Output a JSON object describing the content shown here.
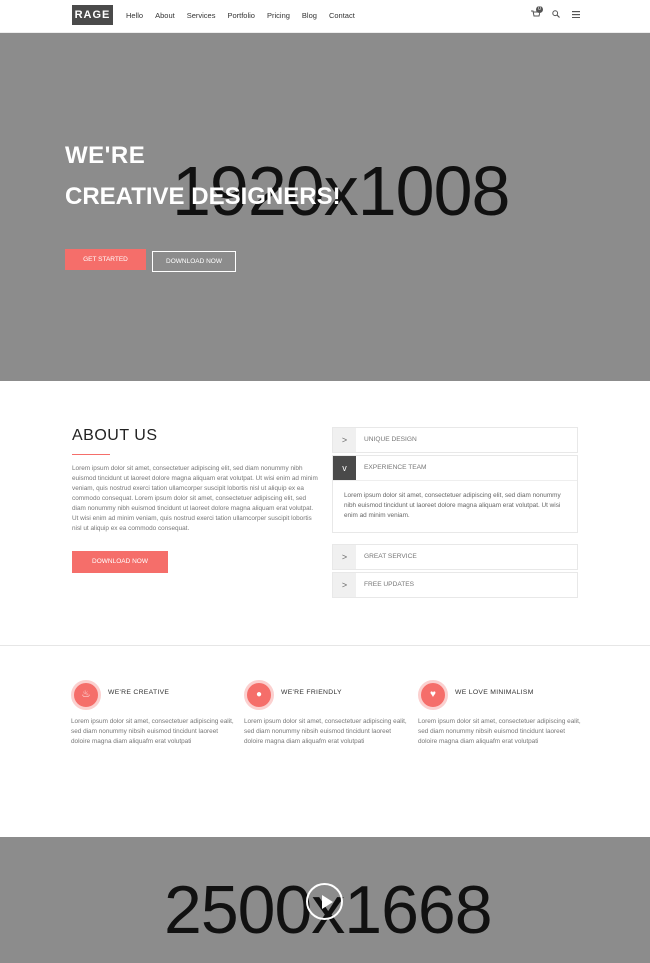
{
  "nav": {
    "logo": "RAGE",
    "menu": [
      "Hello",
      "About",
      "Services",
      "Portfolio",
      "Pricing",
      "Blog",
      "Contact"
    ],
    "cart_icon": "cart-icon",
    "cart_count": "0",
    "search_icon": "search-icon",
    "menu_icon": "hamburger-icon"
  },
  "hero": {
    "placeholder": "1920x1008",
    "line1": "WE'RE",
    "line2": "CREATIVE DESIGNERS!",
    "primary_button": "GET STARTED",
    "secondary_button": "DOWNLOAD NOW"
  },
  "about": {
    "title": "ABOUT US",
    "text": "Lorem ipsum dolor sit amet, consectetuer adipiscing elit, sed diam nonummy nibh euismod tincidunt ut laoreet dolore magna aliquam erat volutpat. Ut wisi enim ad minim veniam, quis nostrud exerci tation ullamcorper suscipit lobortis nisl ut aliquip ex ea commodo consequat. Lorem ipsum dolor sit amet, consectetuer adipiscing elit, sed diam nonummy nibh euismod tincidunt ut laoreet dolore magna aliquam erat volutpat. Ut wisi enim ad minim veniam, quis nostrud exerci tation ullamcorper suscipit lobortis nisl ut aliquip ex ea commodo consequat.",
    "button": "DOWNLOAD NOW"
  },
  "accordion": [
    {
      "label": "UNIQUE DESIGN",
      "icon": ">",
      "open": false
    },
    {
      "label": "EXPERIENCE TEAM",
      "icon": "v",
      "open": true,
      "body": "Lorem ipsum dolor sit amet, consectetuer adipiscing elit, sed diam nonummy nibh euismod tincidunt ut laoreet dolore magna aliquam erat volutpat. Ut wisi enim ad minim veniam."
    },
    {
      "label": "GREAT SERVICE",
      "icon": ">",
      "open": false
    },
    {
      "label": "FREE UPDATES",
      "icon": ">",
      "open": false
    }
  ],
  "features": [
    {
      "title": "WE'RE CREATIVE",
      "icon": "flame-icon",
      "glyph": "♨",
      "text": "Lorem ipsum dolor sit amet, consectetuer adipiscing ealit, sed diam nonummy nibsih euismod tincidunt laoreet doloire magna diam aliquafm erat volutpati"
    },
    {
      "title": "WE'RE FRIENDLY",
      "icon": "chat-icon",
      "glyph": "●",
      "text": "Lorem ipsum dolor sit amet, consectetuer adipiscing ealit, sed diam nonummy nibsih euismod tincidunt laoreet doloire magna diam aliquafm erat volutpati"
    },
    {
      "title": "WE LOVE MINIMALISM",
      "icon": "heart-icon",
      "glyph": "♥",
      "text": "Lorem ipsum dolor sit amet, consectetuer adipiscing ealit, sed diam nonummy nibsih euismod tincidunt laoreet doloire magna diam aliquafm erat volutpati"
    }
  ],
  "video": {
    "placeholder": "2500x1668",
    "play_icon": "play-icon"
  },
  "colors": {
    "accent": "#f56e6a",
    "placeholder_bg": "#8c8c8c",
    "dark": "#4a4a4a"
  }
}
